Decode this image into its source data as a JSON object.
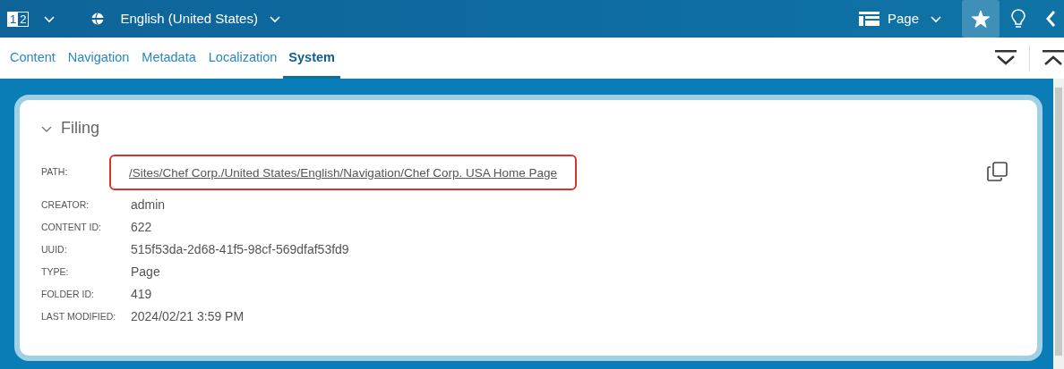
{
  "toolbar": {
    "compare_icon": [
      "1",
      "2"
    ],
    "language": "English (United States)",
    "view": "Page",
    "favorite": {
      "on": true
    }
  },
  "tabs": [
    {
      "label": "Content",
      "selected": false
    },
    {
      "label": "Navigation",
      "selected": false
    },
    {
      "label": "Metadata",
      "selected": false
    },
    {
      "label": "Localization",
      "selected": false
    },
    {
      "label": "System",
      "selected": true
    }
  ],
  "section": {
    "title": "Filing",
    "expanded": true,
    "fields": [
      {
        "label": "PATH:",
        "value": "/Sites/Chef Corp./United States/English/Navigation/Chef Corp. USA Home Page",
        "kind": "link",
        "highlighted": true
      },
      {
        "label": "CREATOR:",
        "value": "admin",
        "kind": "text"
      },
      {
        "label": "CONTENT ID:",
        "value": "622",
        "kind": "text"
      },
      {
        "label": "UUID:",
        "value": "515f53da-2d68-41f5-98cf-569dfaf53fd9",
        "kind": "text"
      },
      {
        "label": "TYPE:",
        "value": "Page",
        "kind": "text"
      },
      {
        "label": "FOLDER ID:",
        "value": "419",
        "kind": "text"
      },
      {
        "label": "LAST MODIFIED:",
        "value": "2024/02/21 3:59 PM",
        "kind": "text"
      }
    ]
  }
}
